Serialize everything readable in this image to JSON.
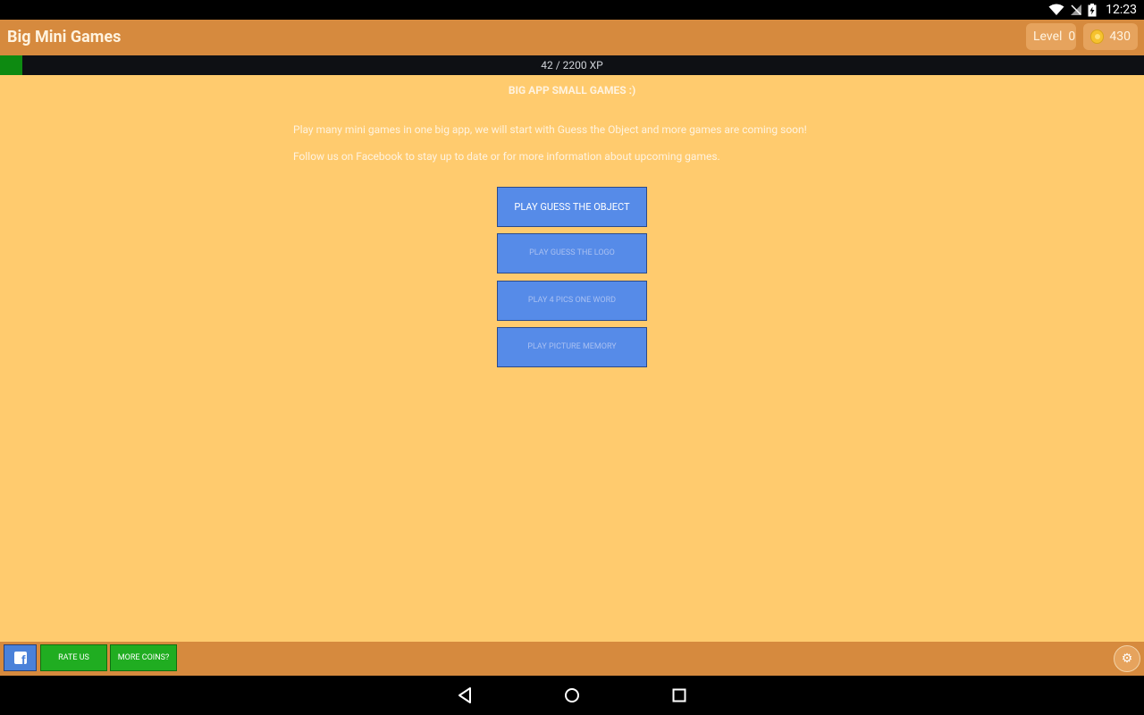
{
  "status": {
    "time": "12:23"
  },
  "app": {
    "title": "Big Mini Games",
    "level_label": "Level",
    "level_value": "0",
    "coins": "430"
  },
  "xp": {
    "text": "42 / 2200 XP",
    "current": 42,
    "max": 2200
  },
  "content": {
    "headline": "BIG APP SMALL GAMES :)",
    "desc1": "Play many mini games in one big app, we will start with Guess the Object and more games are coming soon!",
    "desc2": "Follow us on Facebook to stay up to date or for more information about upcoming games.",
    "buttons": [
      {
        "label": "PLAY GUESS THE OBJECT",
        "enabled": true
      },
      {
        "label": "PLAY GUESS THE LOGO",
        "enabled": false
      },
      {
        "label": "PLAY 4 PICS ONE WORD",
        "enabled": false
      },
      {
        "label": "PLAY PICTURE MEMORY",
        "enabled": false
      }
    ]
  },
  "bottom": {
    "rate_label": "RATE US",
    "more_coins_label": "MORE COINS?"
  },
  "colors": {
    "background": "#ffcb6e",
    "appbar": "#d68a3e",
    "button_blue": "#568be8",
    "button_green": "#20ad21",
    "xp_fill": "#0d8a11"
  },
  "icons": {
    "wifi": "wifi-icon",
    "signal": "no-signal-icon",
    "battery": "battery-charging-icon",
    "coin": "coin-icon",
    "facebook": "facebook-icon",
    "settings": "gear-icon",
    "back": "back-icon",
    "home": "home-icon",
    "recents": "recents-icon"
  }
}
